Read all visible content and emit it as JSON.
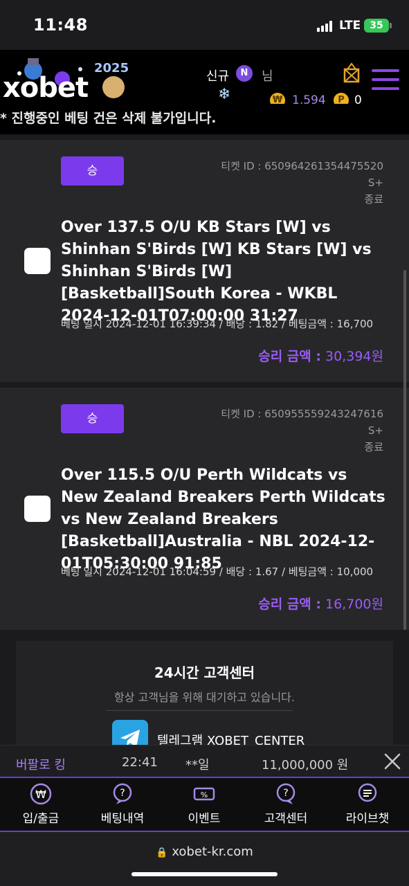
{
  "status_bar": {
    "time": "11:48",
    "network": "LTE",
    "battery": "35"
  },
  "header": {
    "logo_text": "xobet",
    "logo_year": "2025",
    "signup_label": "신규",
    "notification_badge": "N",
    "user_label": "님",
    "coin_points": "1,594",
    "points": "0",
    "coin_symbol": "₩",
    "point_symbol": "P"
  },
  "notice_text": "* 진행중인 베팅 건은 삭제 불가입니다.",
  "tickets": [
    {
      "result_badge": "승",
      "ticket_id": "티켓 ID : 650964261354475520",
      "grade": "S+",
      "status": "종료",
      "title": "Over 137.5 O/U KB Stars [W] vs Shinhan S'Birds [W] KB Stars [W] vs Shinhan S'Birds [W] [Basketball]South Korea - WKBL 2024-12-01T07:00:00 31:27",
      "meta": "베팅 일시 2024-12-01 16:39:34 / 배당 : 1.82 / 베팅금액 : 16,700",
      "win_label": "승리 금액 :",
      "win_amount": "30,394원"
    },
    {
      "result_badge": "승",
      "ticket_id": "티켓 ID : 650955559243247616",
      "grade": "S+",
      "status": "종료",
      "title": "Over 115.5 O/U Perth Wildcats vs New Zealand Breakers Perth Wildcats vs New Zealand Breakers [Basketball]Australia - NBL 2024-12-01T05:30:00 91:85",
      "meta": "베팅 일시 2024-12-01 16:04:59 / 배당 : 1.67 / 베팅금액 : 10,000",
      "win_label": "승리 금액 :",
      "win_amount": "16,700원"
    }
  ],
  "support": {
    "title": "24시간 고객센터",
    "subtitle": "항상 고객님을 위해 대기하고 있습니다.",
    "telegram_label": "텔레그램 XOBET_CENTER"
  },
  "ticker": {
    "game": "버팔로 킹",
    "time": "22:41",
    "user": "**일",
    "amount": "11,000,000 원"
  },
  "bottom_nav": [
    {
      "label": "입/출금",
      "icon": "won-icon"
    },
    {
      "label": "베팅내역",
      "icon": "history-icon"
    },
    {
      "label": "이벤트",
      "icon": "event-ticket-icon"
    },
    {
      "label": "고객센터",
      "icon": "support-icon"
    },
    {
      "label": "라이브챗",
      "icon": "chat-icon"
    }
  ],
  "browser": {
    "url": "xobet-kr.com"
  },
  "colors": {
    "accent": "#7c3aed",
    "win_text": "#9b5cf6",
    "card_bg": "#27272a",
    "coin": "#f0b21c"
  }
}
